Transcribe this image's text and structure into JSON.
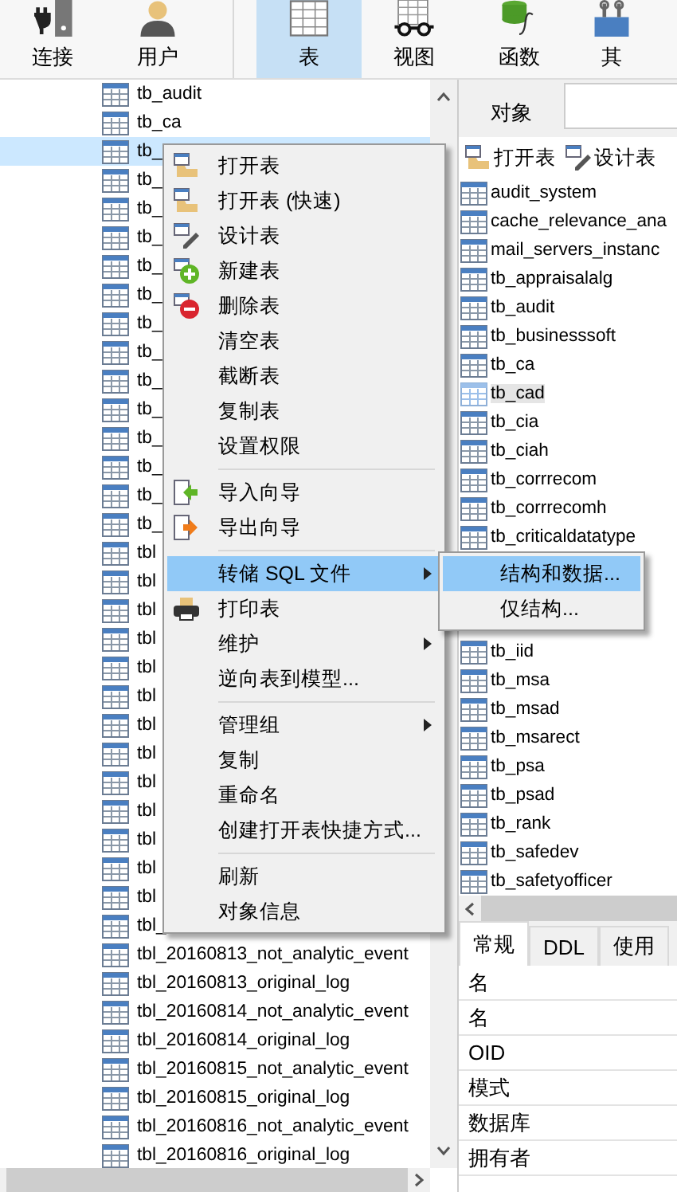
{
  "toolbar": [
    {
      "kind": "connect",
      "label": "连接",
      "selected": false
    },
    {
      "kind": "user",
      "label": "用户",
      "selected": false
    },
    {
      "kind": "separator"
    },
    {
      "kind": "table",
      "label": "表",
      "selected": true
    },
    {
      "kind": "view",
      "label": "视图",
      "selected": false
    },
    {
      "kind": "function",
      "label": "函数",
      "selected": false
    },
    {
      "kind": "other",
      "label": "其",
      "selected": false
    }
  ],
  "tree": {
    "rows": [
      {
        "label": "tb_audit",
        "selected": false
      },
      {
        "label": "tb_ca",
        "selected": false
      },
      {
        "label": "tb_",
        "selected": true
      },
      {
        "label": "tb_",
        "selected": false
      },
      {
        "label": "tb_",
        "selected": false
      },
      {
        "label": "tb_",
        "selected": false
      },
      {
        "label": "tb_",
        "selected": false
      },
      {
        "label": "tb_",
        "selected": false
      },
      {
        "label": "tb_",
        "selected": false
      },
      {
        "label": "tb_",
        "selected": false
      },
      {
        "label": "tb_",
        "selected": false
      },
      {
        "label": "tb_",
        "selected": false
      },
      {
        "label": "tb_",
        "selected": false
      },
      {
        "label": "tb_",
        "selected": false
      },
      {
        "label": "tb_",
        "selected": false
      },
      {
        "label": "tb_",
        "selected": false
      },
      {
        "label": "tbl",
        "selected": false
      },
      {
        "label": "tbl",
        "selected": false
      },
      {
        "label": "tbl",
        "selected": false
      },
      {
        "label": "tbl",
        "selected": false
      },
      {
        "label": "tbl",
        "selected": false
      },
      {
        "label": "tbl",
        "selected": false
      },
      {
        "label": "tbl",
        "selected": false
      },
      {
        "label": "tbl",
        "selected": false
      },
      {
        "label": "tbl",
        "selected": false
      },
      {
        "label": "tbl",
        "selected": false
      },
      {
        "label": "tbl",
        "selected": false
      },
      {
        "label": "tbl",
        "selected": false
      },
      {
        "label": "tbl",
        "selected": false
      },
      {
        "label": "tbl_",
        "selected": false
      },
      {
        "label": "tbl_20160813_not_analytic_event",
        "selected": false
      },
      {
        "label": "tbl_20160813_original_log",
        "selected": false
      },
      {
        "label": "tbl_20160814_not_analytic_event",
        "selected": false
      },
      {
        "label": "tbl_20160814_original_log",
        "selected": false
      },
      {
        "label": "tbl_20160815_not_analytic_event",
        "selected": false
      },
      {
        "label": "tbl_20160815_original_log",
        "selected": false
      },
      {
        "label": "tbl_20160816_not_analytic_event",
        "selected": false
      },
      {
        "label": "tbl_20160816_original_log",
        "selected": false
      }
    ]
  },
  "context_menu": {
    "items": [
      {
        "kind": "folder",
        "label": "打开表",
        "selected": false,
        "submenu": false
      },
      {
        "kind": "folder",
        "label": "打开表 (快速)",
        "selected": false,
        "submenu": false
      },
      {
        "kind": "pencil",
        "label": "设计表",
        "selected": false,
        "submenu": false
      },
      {
        "kind": "plus",
        "label": "新建表",
        "selected": false,
        "submenu": false
      },
      {
        "kind": "minus",
        "label": "删除表",
        "selected": false,
        "submenu": false
      },
      {
        "kind": "plain",
        "label": "清空表",
        "selected": false,
        "submenu": false
      },
      {
        "kind": "plain",
        "label": "截断表",
        "selected": false,
        "submenu": false
      },
      {
        "kind": "plain",
        "label": "复制表",
        "selected": false,
        "submenu": false
      },
      {
        "kind": "plain",
        "label": "设置权限",
        "selected": false,
        "submenu": false
      },
      {
        "kind": "separator"
      },
      {
        "kind": "import",
        "label": "导入向导",
        "selected": false,
        "submenu": false
      },
      {
        "kind": "export",
        "label": "导出向导",
        "selected": false,
        "submenu": false
      },
      {
        "kind": "separator"
      },
      {
        "kind": "plain",
        "label": "转储 SQL 文件",
        "selected": true,
        "submenu": true
      },
      {
        "kind": "printer",
        "label": "打印表",
        "selected": false,
        "submenu": false
      },
      {
        "kind": "plain",
        "label": "维护",
        "selected": false,
        "submenu": true
      },
      {
        "kind": "plain",
        "label": "逆向表到模型...",
        "selected": false,
        "submenu": false
      },
      {
        "kind": "separator"
      },
      {
        "kind": "plain",
        "label": "管理组",
        "selected": false,
        "submenu": true
      },
      {
        "kind": "plain",
        "label": "复制",
        "selected": false,
        "submenu": false
      },
      {
        "kind": "plain",
        "label": "重命名",
        "selected": false,
        "submenu": false
      },
      {
        "kind": "plain",
        "label": "创建打开表快捷方式...",
        "selected": false,
        "submenu": false
      },
      {
        "kind": "separator"
      },
      {
        "kind": "plain",
        "label": "刷新",
        "selected": false,
        "submenu": false
      },
      {
        "kind": "plain",
        "label": "对象信息",
        "selected": false,
        "submenu": false
      }
    ]
  },
  "submenu": {
    "items": [
      {
        "label": "结构和数据...",
        "selected": true
      },
      {
        "label": "仅结构...",
        "selected": false
      }
    ]
  },
  "objects_panel": {
    "tab": "对象",
    "actions": [
      {
        "kind": "open",
        "label": "打开表"
      },
      {
        "kind": "design",
        "label": "设计表"
      }
    ],
    "list_upper": [
      {
        "label": "audit_system",
        "selected": false
      },
      {
        "label": "cache_relevance_ana",
        "selected": false
      },
      {
        "label": "mail_servers_instanc",
        "selected": false
      },
      {
        "label": "tb_appraisalalg",
        "selected": false
      },
      {
        "label": "tb_audit",
        "selected": false
      },
      {
        "label": "tb_businesssoft",
        "selected": false
      },
      {
        "label": "tb_ca",
        "selected": false
      },
      {
        "label": "tb_cad",
        "selected": true
      },
      {
        "label": "tb_cia",
        "selected": false
      },
      {
        "label": "tb_ciah",
        "selected": false
      },
      {
        "label": "tb_corrrecom",
        "selected": false
      },
      {
        "label": "tb_corrrecomh",
        "selected": false
      },
      {
        "label": "tb_criticaldatatype",
        "selected": false
      }
    ],
    "list_lower": [
      {
        "label": "tb_iid",
        "selected": false
      },
      {
        "label": "tb_msa",
        "selected": false
      },
      {
        "label": "tb_msad",
        "selected": false
      },
      {
        "label": "tb_msarect",
        "selected": false
      },
      {
        "label": "tb_psa",
        "selected": false
      },
      {
        "label": "tb_psad",
        "selected": false
      },
      {
        "label": "tb_rank",
        "selected": false
      },
      {
        "label": "tb_safedev",
        "selected": false
      },
      {
        "label": "tb_safetyofficer",
        "selected": false
      }
    ]
  },
  "properties": {
    "tabs": [
      {
        "label": "常规",
        "selected": true
      },
      {
        "label": "DDL",
        "selected": false
      },
      {
        "label": "使用",
        "selected": false
      }
    ],
    "rows": [
      "名",
      "名",
      "OID",
      "模式",
      "数据库",
      "拥有者"
    ]
  }
}
